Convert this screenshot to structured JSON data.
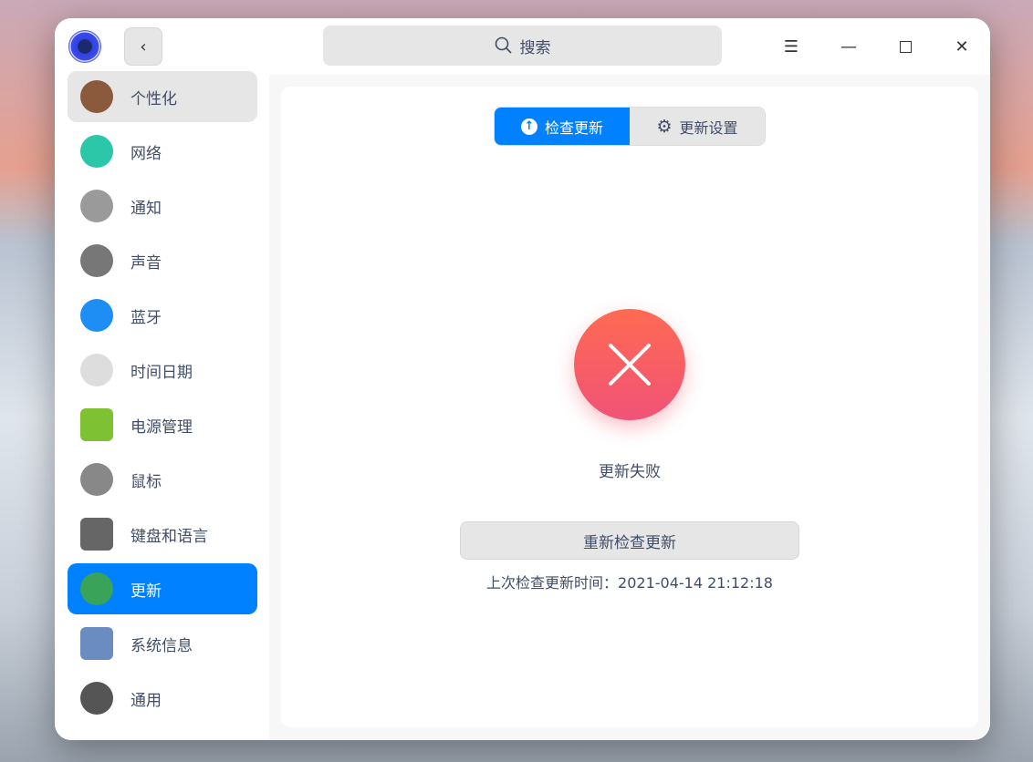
{
  "titlebar": {
    "search_placeholder": "搜索"
  },
  "sidebar": {
    "items": [
      {
        "label": "个性化",
        "icon": "personalization-icon",
        "color": "#8b5a3c"
      },
      {
        "label": "网络",
        "icon": "network-icon",
        "color": "#2bc7a8"
      },
      {
        "label": "通知",
        "icon": "notification-bell-icon",
        "color": "#9a9a9a"
      },
      {
        "label": "声音",
        "icon": "sound-speaker-icon",
        "color": "#777"
      },
      {
        "label": "蓝牙",
        "icon": "bluetooth-icon",
        "color": "#1e8ef5"
      },
      {
        "label": "时间日期",
        "icon": "clock-icon",
        "color": "#ddd"
      },
      {
        "label": "电源管理",
        "icon": "battery-icon",
        "color": "#7ec234"
      },
      {
        "label": "鼠标",
        "icon": "mouse-icon",
        "color": "#888"
      },
      {
        "label": "键盘和语言",
        "icon": "keyboard-icon",
        "color": "#666"
      },
      {
        "label": "更新",
        "icon": "update-icon",
        "color": "#3aa35a"
      },
      {
        "label": "系统信息",
        "icon": "system-info-icon",
        "color": "#6a8cc0"
      },
      {
        "label": "通用",
        "icon": "general-gear-icon",
        "color": "#555"
      }
    ]
  },
  "tabs": {
    "check": "检查更新",
    "settings": "更新设置"
  },
  "status": {
    "text": "更新失败",
    "retry": "重新检查更新",
    "last_check": "上次检查更新时间：2021-04-14 21:12:18"
  },
  "colors": {
    "accent": "#0081ff",
    "error": "#f05a66"
  }
}
